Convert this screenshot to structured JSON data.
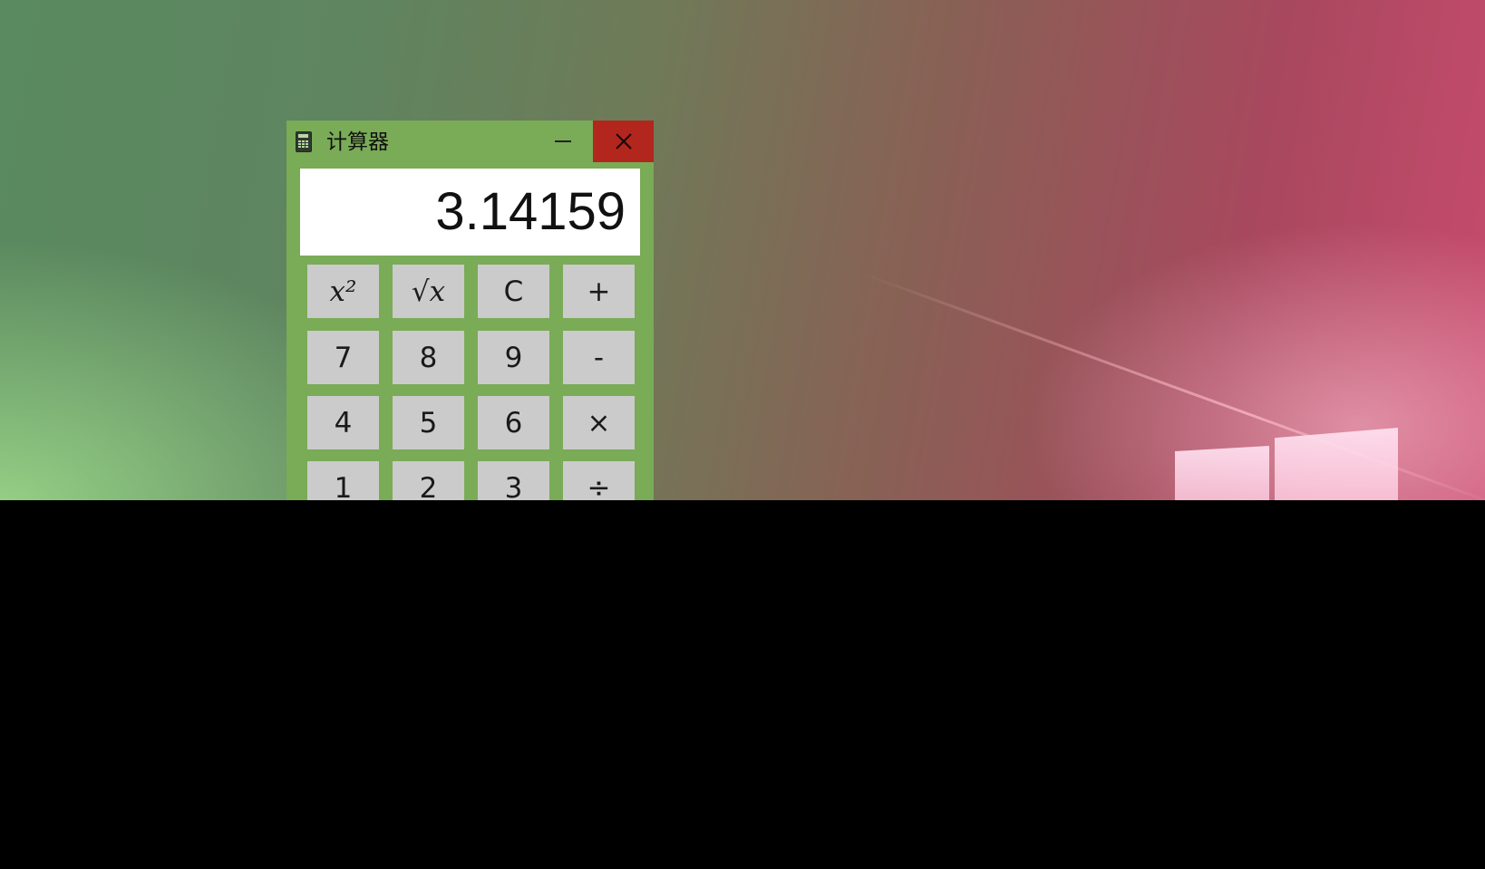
{
  "window": {
    "title": "计算器",
    "icon": "calculator-icon",
    "minimize_icon": "minimize-icon",
    "close_icon": "close-icon",
    "accent": "#7aab57",
    "close_color": "#b3261e"
  },
  "display": {
    "value": "3.14159"
  },
  "keypad": {
    "rows": [
      [
        "x²",
        "√x",
        "C",
        "+"
      ],
      [
        "7",
        "8",
        "9",
        "-"
      ],
      [
        "4",
        "5",
        "6",
        "×"
      ],
      [
        "1",
        "2",
        "3",
        "÷"
      ]
    ]
  }
}
